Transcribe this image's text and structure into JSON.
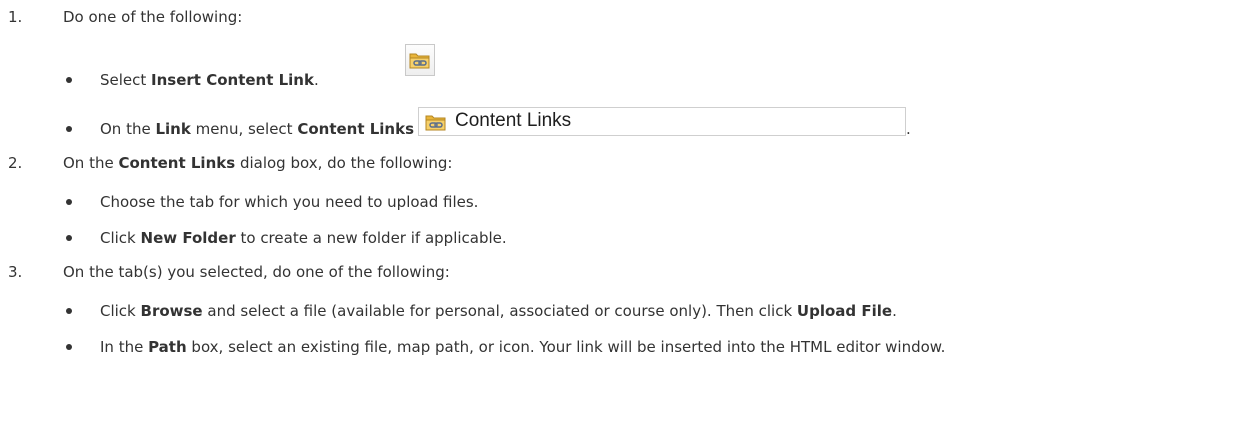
{
  "steps": [
    {
      "number": "1.",
      "text": "Do one of the following:",
      "items": [
        {
          "pre": "Select ",
          "bold": "Insert Content Link",
          "post": ".",
          "icon": "content-link-icon"
        },
        {
          "pre": "On the ",
          "bold1": "Link",
          "mid": " menu, select ",
          "bold2": "Content Links",
          "menu_label": "Content Links",
          "post": "."
        }
      ]
    },
    {
      "number": "2.",
      "pre": "On the ",
      "bold": "Content Links",
      "post": " dialog box, do the following:",
      "items": [
        {
          "text": "Choose the tab for which you need to upload files."
        },
        {
          "pre": "Click ",
          "bold": "New Folder",
          "post": " to create a new folder if applicable."
        }
      ]
    },
    {
      "number": "3.",
      "text": "On the tab(s) you selected, do one of the following:",
      "items": [
        {
          "pre": "Click ",
          "bold": "Browse",
          "mid": " and select a file (available for personal, associated or course only). Then click ",
          "bold2": "Upload File",
          "post": "."
        },
        {
          "pre": "In the ",
          "bold": "Path",
          "post": " box, select an existing file, map path, or icon. Your link will be inserted into the HTML editor window."
        }
      ]
    }
  ],
  "colors": {
    "text": "#333333",
    "folder": "#e9b53a",
    "chain": "#5a6e8c"
  }
}
